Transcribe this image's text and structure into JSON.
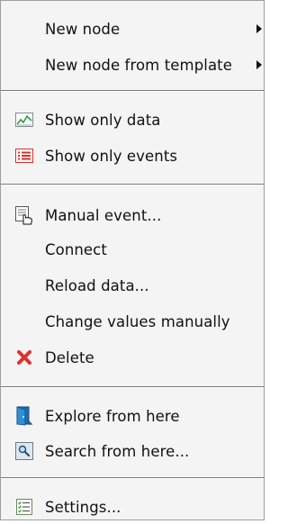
{
  "menu": {
    "items": [
      {
        "label": "New node",
        "icon": "",
        "submenu": true
      },
      {
        "label": "New node from template",
        "icon": "",
        "submenu": true
      },
      {
        "label": "Show only data",
        "icon": "chart-line-icon",
        "submenu": false
      },
      {
        "label": "Show only events",
        "icon": "event-list-icon",
        "submenu": false
      },
      {
        "label": "Manual event...",
        "icon": "manual-event-icon",
        "submenu": false
      },
      {
        "label": "Connect",
        "icon": "",
        "submenu": false
      },
      {
        "label": "Reload data...",
        "icon": "",
        "submenu": false
      },
      {
        "label": "Change values manually",
        "icon": "",
        "submenu": false
      },
      {
        "label": "Delete",
        "icon": "delete-x-icon",
        "submenu": false
      },
      {
        "label": "Explore from here",
        "icon": "explore-door-icon",
        "submenu": false
      },
      {
        "label": "Search from here...",
        "icon": "search-magnifier-icon",
        "submenu": false
      },
      {
        "label": "Settings...",
        "icon": "settings-list-icon",
        "submenu": false
      }
    ]
  },
  "colors": {
    "menu_background": "#f4f4f4",
    "separator": "#7a7a7a",
    "delete_red": "#e0302a"
  }
}
